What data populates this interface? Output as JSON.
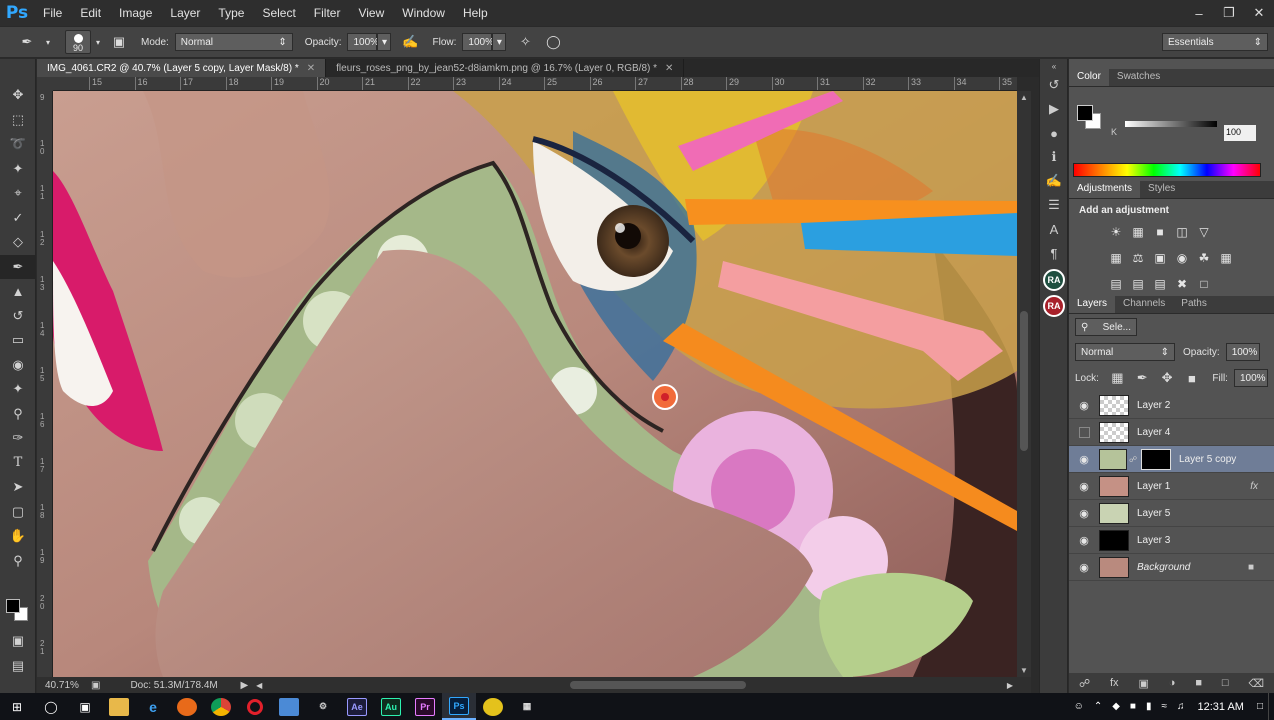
{
  "app": {
    "logo": "Ps"
  },
  "menu": [
    "File",
    "Edit",
    "Image",
    "Layer",
    "Type",
    "Select",
    "Filter",
    "View",
    "Window",
    "Help"
  ],
  "window_controls": {
    "minimize": "–",
    "restore": "❐",
    "close": "✕"
  },
  "options": {
    "brush_size": "90",
    "mode_label": "Mode:",
    "mode_value": "Normal",
    "opacity_label": "Opacity:",
    "opacity_value": "100%",
    "flow_label": "Flow:",
    "flow_value": "100%",
    "workspace": "Essentials"
  },
  "document_tabs": [
    {
      "label": "IMG_4061.CR2 @ 40.7% (Layer 5 copy, Layer Mask/8) *",
      "active": true
    },
    {
      "label": "fleurs_roses_png_by_jean52-d8iamkm.png @ 16.7% (Layer 0, RGB/8) *",
      "active": false
    }
  ],
  "ruler_h": [
    "15",
    "16",
    "17",
    "18",
    "19",
    "20",
    "21",
    "22",
    "23",
    "24",
    "25",
    "26",
    "27",
    "28",
    "29",
    "30",
    "31",
    "32",
    "33",
    "34",
    "35"
  ],
  "ruler_v": [
    "9",
    "1 0",
    "1 1",
    "1 2",
    "1 3",
    "1 4",
    "1 5",
    "1 6",
    "1 7",
    "1 8",
    "1 9",
    "2 0",
    "2 1"
  ],
  "status": {
    "zoom": "40.71%",
    "doc": "Doc: 51.3M/178.4M"
  },
  "color_panel": {
    "tabs": [
      "Color",
      "Swatches"
    ],
    "k_label": "K",
    "k_value": "100"
  },
  "adjustments": {
    "tabs": [
      "Adjustments",
      "Styles"
    ],
    "title": "Add an adjustment"
  },
  "layers_panel": {
    "tabs": [
      "Layers",
      "Channels",
      "Paths"
    ],
    "filter_kind": "Sele...",
    "blend_mode": "Normal",
    "opacity_label": "Opacity:",
    "opacity_value": "100%",
    "lock_label": "Lock:",
    "fill_label": "Fill:",
    "fill_value": "100%",
    "layers": [
      {
        "name": "Layer 2",
        "visible": true
      },
      {
        "name": "Layer 4",
        "visible": false
      },
      {
        "name": "Layer 5 copy",
        "visible": true,
        "selected": true,
        "mask": true
      },
      {
        "name": "Layer 1",
        "visible": true,
        "fx": "fx"
      },
      {
        "name": "Layer 5",
        "visible": true
      },
      {
        "name": "Layer 3",
        "visible": true
      },
      {
        "name": "Background",
        "visible": true,
        "locked": true
      }
    ]
  },
  "side_badges": [
    "RA",
    "RA"
  ],
  "taskbar": {
    "time": "12:31 AM"
  }
}
